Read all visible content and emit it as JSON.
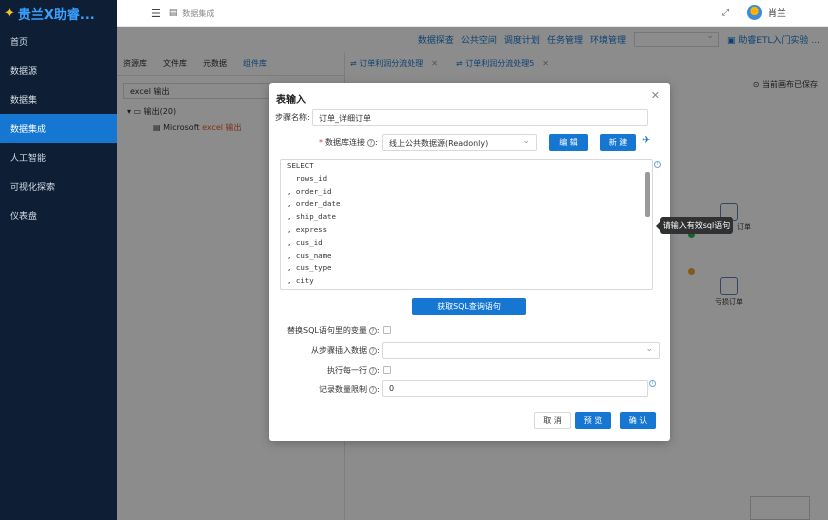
{
  "app": {
    "logo_text": "贵兰X助睿..."
  },
  "sidebar": {
    "items": [
      {
        "label": "首页"
      },
      {
        "label": "数据源"
      },
      {
        "label": "数据集"
      },
      {
        "label": "数据集成",
        "active": true
      },
      {
        "label": "人工智能"
      },
      {
        "label": "可视化探索"
      },
      {
        "label": "仪表盘"
      }
    ]
  },
  "header": {
    "breadcrumb": "数据集成",
    "user_name": "肖兰"
  },
  "menubar": {
    "items": [
      "数据探查",
      "公共空间",
      "调度计划",
      "任务管理",
      "环境管理"
    ],
    "guide_link": "助睿ETL入门实验 ..."
  },
  "left_panel": {
    "tabs": [
      "资源库",
      "文件库",
      "元数据",
      "组件库"
    ],
    "active_tab": "组件库",
    "search_value": "excel 输出",
    "tree_root": "输出(20)",
    "tree_child_prefix": "Microsoft ",
    "tree_child_highlight": "excel 输出"
  },
  "canvas": {
    "tabs": [
      "订单利润分流处理",
      "订单利润分流处理5"
    ],
    "saved_status": "当前画布已保存",
    "node_labels": [
      "订单",
      "亏损订单"
    ]
  },
  "dialog": {
    "title": "表输入",
    "step_name_label": "步骤名称",
    "step_name_value": "订单_详细订单",
    "db_conn_label": "数据库连接",
    "db_conn_value": "线上公共数据源(Readonly)",
    "edit_button": "编 辑",
    "new_button": "新 建",
    "sql_lines": [
      "SELECT",
      "  rows_id",
      ", order_id",
      ", order_date",
      ", ship_date",
      ", express",
      ", cus_id",
      ", cus_name",
      ", cus_type",
      ", city"
    ],
    "get_sql_button": "获取SQL查询语句",
    "replace_vars_label": "替换SQL语句里的变量",
    "insert_from_step_label": "从步骤插入数据",
    "insert_from_step_value": "",
    "execute_each_row_label": "执行每一行",
    "record_limit_label": "记录数量限制",
    "record_limit_value": "0",
    "cancel_button": "取 消",
    "preview_button": "预 览",
    "confirm_button": "确 认"
  },
  "tooltip": {
    "text": "请输入有效sql语句"
  },
  "colors": {
    "primary": "#1677d2",
    "sidebar_bg": "#0e1f35",
    "required": "#e23b3b"
  }
}
